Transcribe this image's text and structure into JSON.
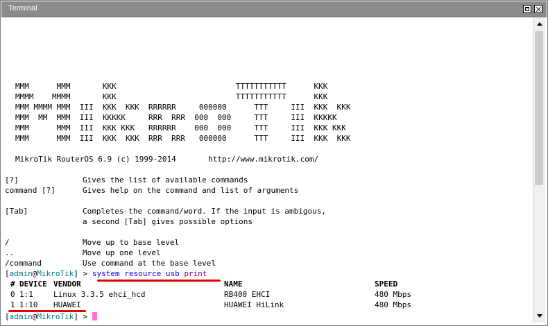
{
  "window": {
    "title": "Terminal"
  },
  "banner": [
    "MMM      MMM       KKK                          TTTTTTTTTTT      KKK",
    "MMMM    MMMM       KKK                          TTTTTTTTTTT      KKK",
    "MMM MMMM MMM  III  KKK  KKK  RRRRRR     000000      TTT     III  KKK  KKK",
    "MMM  MM  MMM  III  KKKKK     RRR  RRR  000  000     TTT     III  KKKKK",
    "MMM      MMM  III  KKK KKK   RRRRRR    000  000     TTT     III  KKK KKK",
    "MMM      MMM  III  KKK  KKK  RRR  RRR   000000      TTT     III  KKK  KKK"
  ],
  "version_line": "MikroTik RouterOS 6.9 (c) 1999-2014       http://www.mikrotik.com/",
  "help": [
    {
      "key": "[?]",
      "desc": "Gives the list of available commands"
    },
    {
      "key": "command [?]",
      "desc": "Gives help on the command and list of arguments"
    },
    {
      "key": "[Tab]",
      "desc": "Completes the command/word. If the input is ambigous,"
    },
    {
      "key": "",
      "desc": "a second [Tab] gives possible options"
    },
    {
      "key": "/",
      "desc": "Move up to base level"
    },
    {
      "key": "..",
      "desc": "Move up one level"
    },
    {
      "key": "/command",
      "desc": "Use command at the base level"
    }
  ],
  "prompt": {
    "open": "[",
    "user": "admin",
    "at": "@",
    "host": "MikroTik",
    "close": "]",
    "arrow": " > "
  },
  "command": {
    "text": "system resource usb ",
    "keyword": "print"
  },
  "table": {
    "headers": {
      "num": "#",
      "device": "DEVICE",
      "vendor": "VENDOR",
      "name": "NAME",
      "speed": "SPEED"
    },
    "rows": [
      {
        "num": "0",
        "device": "1:1",
        "vendor": "Linux 3.3.5 ehci_hcd",
        "name": "RB400 EHCI",
        "speed": "480 Mbps"
      },
      {
        "num": "1",
        "device": "1:10",
        "vendor": "HUAWEI",
        "name": "HUAWEI HiLink",
        "speed": "480 Mbps"
      }
    ]
  },
  "colors": {
    "titlebar": "#8a8a8a",
    "prompt_user": "#008080",
    "command": "#0000ff",
    "keyword": "#8a008a",
    "cursor": "#ff70d0",
    "annotation": "#e00000"
  }
}
